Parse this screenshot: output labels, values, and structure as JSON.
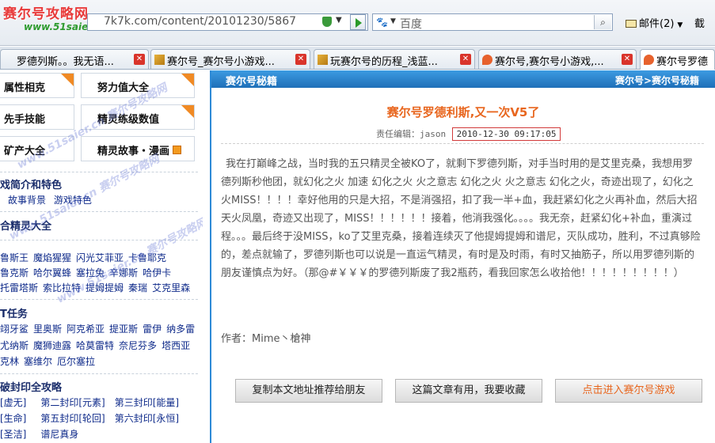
{
  "toolbar": {
    "site_logo": "赛尔号攻略网",
    "site_logo_url": "www.51saier.cn",
    "address": "7k7k.com/content/20101230/5867",
    "search_placeholder": "百度",
    "mail_label": "邮件(2)",
    "tools_label": "截"
  },
  "tabs": [
    {
      "label": "罗德列斯。。我无语..."
    },
    {
      "label": "赛尔号_赛尔号小游戏..."
    },
    {
      "label": "玩赛尔号的历程_浅蓝..."
    },
    {
      "label": "赛尔号,赛尔号小游戏,..."
    },
    {
      "label": "赛尔号罗德"
    }
  ],
  "sidebar": {
    "buttons": [
      {
        "label": "属性相克"
      },
      {
        "label": "努力值大全"
      },
      {
        "label": "先手技能"
      },
      {
        "label": "精灵练级数值"
      },
      {
        "label": "矿产大全"
      },
      {
        "label": "精灵故事・漫画"
      }
    ],
    "sec1_title": "戏简介和特色",
    "sec1_links": [
      "故事背景",
      "游戏特色"
    ],
    "sec2_title": "合精灵大全",
    "sec2_rows": [
      [
        "鲁斯王",
        "魔焰猩猩",
        "闪光艾菲亚",
        "卡鲁耶克"
      ],
      [
        "鲁克斯",
        "哈尔翼蜂",
        "塞拉兔",
        "辛娜斯",
        "哈伊卡"
      ],
      [
        "托雷塔斯",
        "索比拉特",
        "提姆提姆",
        "秦瑞",
        "艾克里森"
      ]
    ],
    "sec3_title": "T任务",
    "sec3_rows": [
      [
        "翊牙鲨",
        "里奥斯",
        "阿克希亚",
        "提亚斯",
        "雷伊",
        "纳多雷"
      ],
      [
        "尤纳斯",
        "魔狮迪露",
        "哈莫雷特",
        "奈尼芬多",
        "塔西亚"
      ],
      [
        "克林",
        "塞维尔",
        "厄尔塞拉"
      ]
    ],
    "sec4_title": "破封印全攻略",
    "sec4_rows": [
      [
        "[虚无]",
        "第二封印[元素]",
        "第三封印[能量]"
      ],
      [
        "[生命]",
        "第五封印[轮回]",
        "第六封印[永恒]"
      ],
      [
        "[圣洁]",
        "谱尼真身"
      ]
    ]
  },
  "main": {
    "header_title": "赛尔号秘籍",
    "breadcrumb": "赛尔号>赛尔号秘籍",
    "article_title": "赛尔号罗德利斯,又一次V5了",
    "editor_label": "责任编辑：jason",
    "date": "2010-12-30 09:17:05",
    "body": "我在打巅峰之战，当时我的五只精灵全被KO了，就剩下罗德列斯，对手当时用的是艾里克桑，我想用罗德列斯秒他团，就幻化之火    加速    幻化之火  火之意志  幻化之火  火之意志   幻化之火，奇迹出现了，幻化之火MISS！！！！幸好他用的只是大招，不是消强招，扣了我一半+血，我赶紧幻化之火再补血，然后大招天火凤凰，奇迹又出现了，MISS！！！！！！接着，他消我强化。。。。我无奈，赶紧幻化+补血，重演过程。。。最后终于没MISS，ko了艾里克桑，接着连续灭了他提姆提姆和谱尼，灭队成功，胜利，不过真够险的，差点就输了，罗德列斯也可以说是一直运气精灵，有时是及时雨，有时又抽筋子，所以用罗德列斯的朋友谨慎点为好。（那@#￥￥￥的罗德列斯废了我2瓶药，看我回家怎么收拾他！！！！！！！！！）",
    "author": "作者：Mime丶槍神",
    "buttons": {
      "recommend": "复制本文地址推荐给朋友",
      "favorite": "这篇文章有用，我要收藏",
      "enter_game": "点击进入赛尔号游戏"
    }
  },
  "colors": {
    "accent": "#e8661e",
    "header_blue": "#1e6fb8",
    "link_blue": "#0e2a8a"
  },
  "watermark": "www.51saier.cn 赛尔号攻略网"
}
